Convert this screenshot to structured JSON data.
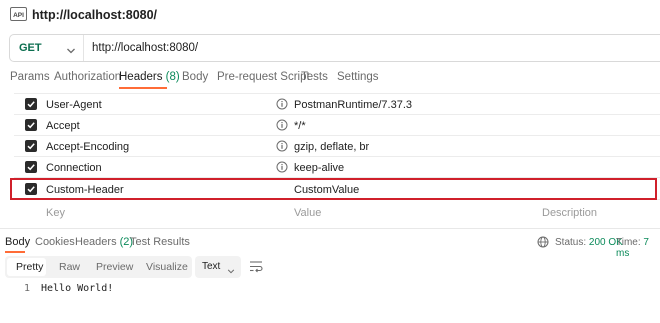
{
  "window": {
    "title": "http://localhost:8080/",
    "icon": "api-request-icon"
  },
  "request": {
    "method": "GET",
    "url": "http://localhost:8080/"
  },
  "request_tabs": [
    {
      "label": "Params",
      "count": ""
    },
    {
      "label": "Authorization",
      "count": ""
    },
    {
      "label": "Headers",
      "count": "(8)",
      "active": true
    },
    {
      "label": "Body",
      "count": ""
    },
    {
      "label": "Pre-request Script",
      "count": ""
    },
    {
      "label": "Tests",
      "count": ""
    },
    {
      "label": "Settings",
      "count": ""
    }
  ],
  "headers": [
    {
      "key": "User-Agent",
      "value": "PostmanRuntime/7.37.3",
      "checked": true,
      "info": true
    },
    {
      "key": "Accept",
      "value": "*/*",
      "checked": true,
      "info": true
    },
    {
      "key": "Accept-Encoding",
      "value": "gzip, deflate, br",
      "checked": true,
      "info": true
    },
    {
      "key": "Connection",
      "value": "keep-alive",
      "checked": true,
      "info": true
    },
    {
      "key": "Custom-Header",
      "value": "CustomValue",
      "checked": true,
      "info": false,
      "highlighted": true
    }
  ],
  "header_placeholders": {
    "key": "Key",
    "value": "Value",
    "description": "Description"
  },
  "response_tabs": [
    {
      "label": "Body",
      "count": "",
      "active": true
    },
    {
      "label": "Cookies",
      "count": ""
    },
    {
      "label": "Headers",
      "count": "(2)"
    },
    {
      "label": "Test Results",
      "count": ""
    }
  ],
  "response_status": {
    "status_label": "Status:",
    "status_value": "200 OK",
    "time_label": "Time:",
    "time_value": "7 ms"
  },
  "body_view": {
    "modes": [
      "Pretty",
      "Raw",
      "Preview",
      "Visualize"
    ],
    "active_mode": "Pretty",
    "format": "Text"
  },
  "body_code": {
    "line_numbers": [
      "1"
    ],
    "lines": [
      "Hello World!"
    ]
  },
  "colors": {
    "accent": "#ff6c37",
    "method": "#0b6e4f",
    "status_ok": "#0b8a5a",
    "highlight": "#d0202b"
  }
}
